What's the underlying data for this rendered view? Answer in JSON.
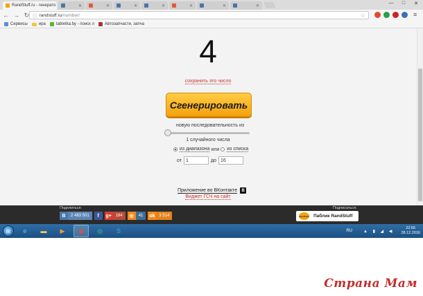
{
  "browser": {
    "tabs": [
      {
        "title": "RandStuff.ru - генерато",
        "active": true,
        "favicon_color": "#f2a30f"
      },
      {
        "title": "",
        "active": false,
        "favicon_color": "#4a76a8"
      },
      {
        "title": "",
        "active": false,
        "favicon_color": "#e05a3c"
      },
      {
        "title": "",
        "active": false,
        "favicon_color": "#4a76a8"
      },
      {
        "title": "",
        "active": false,
        "favicon_color": "#4a76a8"
      },
      {
        "title": "",
        "active": false,
        "favicon_color": "#e05a3c"
      },
      {
        "title": "",
        "active": false,
        "favicon_color": "#4a76a8"
      },
      {
        "title": "",
        "active": false,
        "favicon_color": "#4a76a8"
      }
    ],
    "window_buttons": [
      "—",
      "□",
      "✕"
    ],
    "url": {
      "domain": "randstuff.ru",
      "path": "/number/"
    },
    "bookmarks": [
      {
        "label": "Сервисы",
        "icon": "apps-grid-icon"
      },
      {
        "label": "ира",
        "icon": "folder-icon"
      },
      {
        "label": "tabletka.by - поиск л",
        "icon": "tabletka-icon"
      },
      {
        "label": "Автозапчасти, запча",
        "icon": "autoparts-icon"
      }
    ]
  },
  "page": {
    "number": "4",
    "save_link": "сохранить это число",
    "generate_button": "Сгенерировать",
    "sequence_label": "новую последовательность из",
    "count_label": "1 случайного числа",
    "mode": {
      "range_label": "из диапазона",
      "or": "или",
      "list_label": "из списка",
      "selected": "range"
    },
    "range": {
      "from_label": "от",
      "from_value": "1",
      "to_label": "до",
      "to_value": "16"
    },
    "vk_app_link": "Приложение во ВКонтакте",
    "vk_badge": "В",
    "widget_link": "Виджет ГСЧ на сайт"
  },
  "footer": {
    "share_label": "Поделиться:",
    "subscribe_label": "Подписаться:",
    "shares": [
      {
        "network": "vk",
        "icon_text": "В",
        "count": "2 483 501",
        "color": "#4a76a8"
      },
      {
        "network": "facebook",
        "icon_text": "f",
        "count": "",
        "color": "#3b5998"
      },
      {
        "network": "google-plus",
        "icon_text": "g+",
        "count": "184",
        "color": "#d23f31"
      },
      {
        "network": "odnoklassniki-circle",
        "icon_text": "◎",
        "count": "41",
        "color": "#f28a1a"
      },
      {
        "network": "odnoklassniki",
        "icon_text": "ok",
        "count": "3 514",
        "color": "#f28a1a"
      }
    ],
    "subscribe_button": "Паблик RandStuff",
    "subscribe_logo": "RandStuff"
  },
  "taskbar": {
    "language": "RU",
    "time": "22:55",
    "date": "28.12.2016"
  },
  "watermark": "Страна Мам"
}
